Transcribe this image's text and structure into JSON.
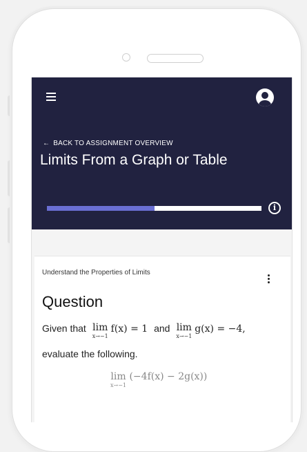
{
  "header": {
    "back_link": "BACK TO ASSIGNMENT OVERVIEW",
    "back_arrow": "←",
    "title": "Limits From a Graph or Table",
    "progress_fraction": 0.5,
    "info_symbol": "i",
    "background_color": "#212240",
    "progress_color": "#6a6fd3"
  },
  "icons": {
    "menu": "menu-icon",
    "account": "account-icon",
    "info": "info-icon",
    "more": "more-vertical-icon"
  },
  "card": {
    "section_title": "Understand the Properties of Limits",
    "heading": "Question",
    "given_prefix": "Given that",
    "lim_word": "lim",
    "lim_sub": "x→−1",
    "f_expr": "f(x) = 1",
    "and_word": "and",
    "g_expr": "g(x) = −4,",
    "instruction": "evaluate the following.",
    "target_expr": "(−4f(x) − 2g(x))"
  }
}
